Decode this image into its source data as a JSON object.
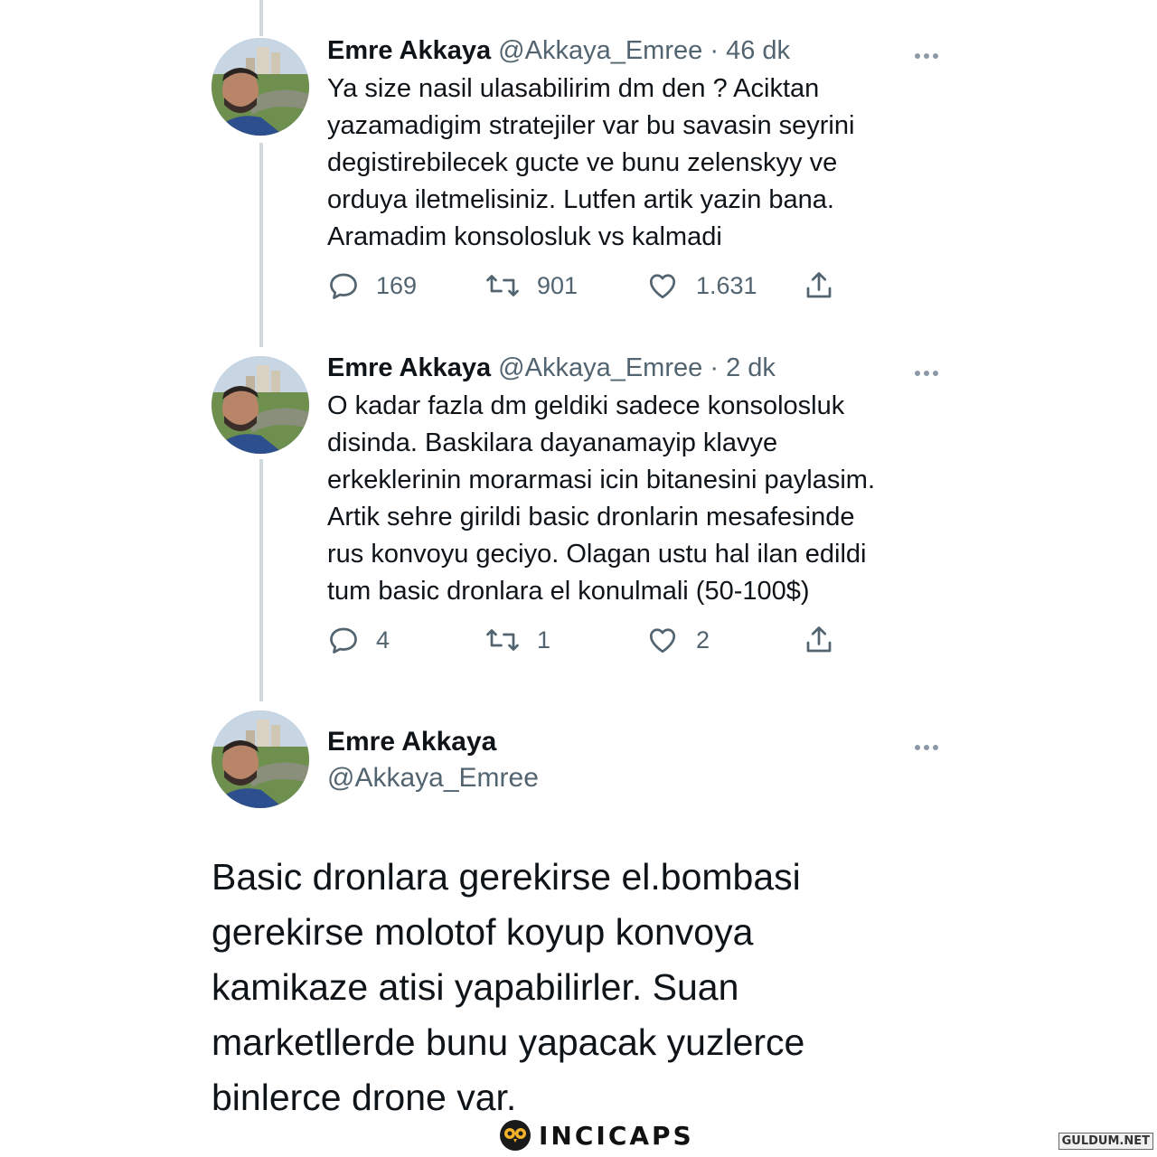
{
  "tweets": [
    {
      "name": "Emre Akkaya",
      "handle": "@Akkaya_Emree",
      "separator": "·",
      "time": "46 dk",
      "lines": [
        "Ya size nasil ulasabilirim dm den ? Aciktan",
        "yazamadigim stratejiler var bu savasin seyrini",
        "degistirebilecek gucte ve bunu zelenskyy ve",
        "orduya iletmelisiniz. Lutfen artik yazin bana.",
        "Aramadim konsolosluk vs kalmadi"
      ],
      "replies": "169",
      "retweets": "901",
      "likes": "1.631"
    },
    {
      "name": "Emre Akkaya",
      "handle": "@Akkaya_Emree",
      "separator": "·",
      "time": "2 dk",
      "lines": [
        "O kadar fazla dm geldiki sadece konsolosluk",
        "disinda. Baskilara dayanamayip klavye",
        "erkeklerinin morarmasi icin bitanesini paylasim.",
        "Artik sehre girildi basic dronlarin mesafesinde",
        "rus konvoyu geciyo. Olagan ustu hal ilan edildi",
        "tum basic dronlara el konulmali (50-100$)"
      ],
      "replies": "4",
      "retweets": "1",
      "likes": "2"
    }
  ],
  "main_tweet": {
    "name": "Emre Akkaya",
    "handle": "@Akkaya_Emree",
    "lines": [
      "Basic dronlara gerekirse el.bombasi",
      "gerekirse molotof koyup konvoya",
      "kamikaze atisi yapabilirler. Suan",
      "marketllerde bunu yapacak yuzlerce",
      "binlerce drone var."
    ]
  },
  "branding": {
    "logo_text": "INCICAPS",
    "watermark": "GULDUM.NET"
  },
  "icons": {
    "reply": "reply-icon",
    "retweet": "retweet-icon",
    "like": "heart-icon",
    "share": "share-icon",
    "more": "more-icon"
  },
  "colors": {
    "text": "#0f1419",
    "secondary": "#536471",
    "thread_line": "#cfd9de"
  }
}
